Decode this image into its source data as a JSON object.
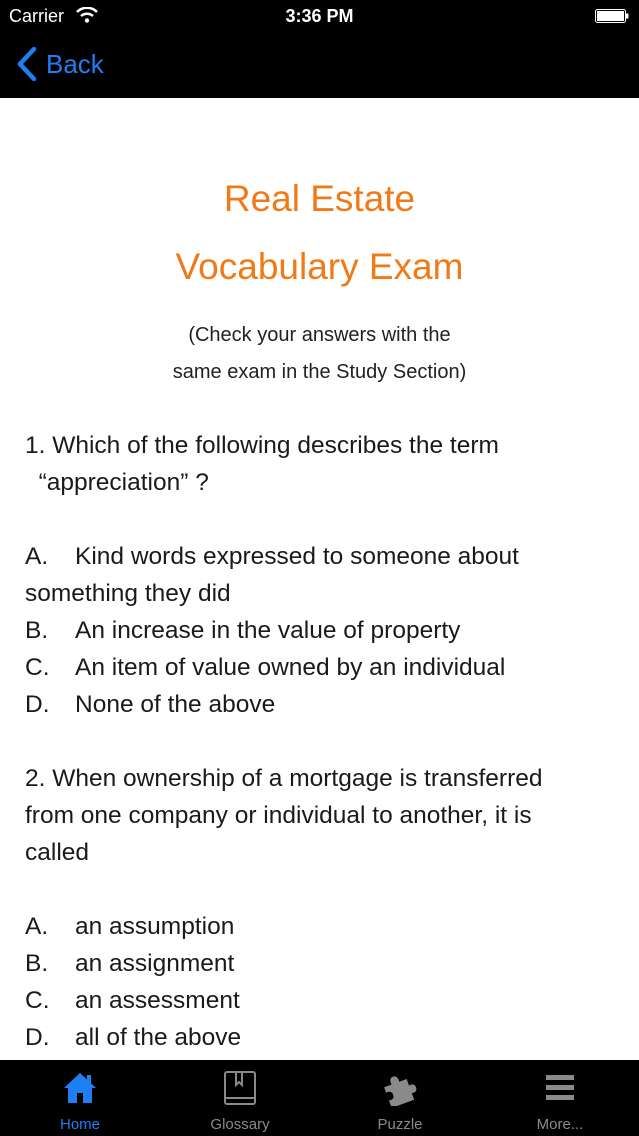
{
  "status_bar": {
    "carrier": "Carrier",
    "time": "3:36 PM"
  },
  "nav": {
    "back_label": "Back"
  },
  "header": {
    "title_line1": "Real Estate",
    "title_line2": "Vocabulary Exam",
    "subtitle_line1": "(Check your answers with the",
    "subtitle_line2": "same exam in the Study Section)"
  },
  "questions": [
    {
      "lines": [
        "1. Which of the following describes the term",
        "  “appreciation” ?"
      ],
      "options": [
        {
          "letter": "A.",
          "text": "Kind words expressed to someone about",
          "cont": "something they did"
        },
        {
          "letter": "B.",
          "text": "An increase in the value of property"
        },
        {
          "letter": "C.",
          "text": "An item of value owned by an individual"
        },
        {
          "letter": "D.",
          "text": "None of the above"
        }
      ]
    },
    {
      "lines": [
        "2. When ownership of a mortgage is transferred",
        "from one company or individual to another, it is",
        "called"
      ],
      "options": [
        {
          "letter": "A.",
          "text": "an assumption"
        },
        {
          "letter": "B.",
          "text": "an assignment"
        },
        {
          "letter": "C.",
          "text": "an assessment"
        },
        {
          "letter": "D.",
          "text": "all of the above"
        }
      ]
    }
  ],
  "tabs": [
    {
      "label": "Home",
      "icon": "home-icon",
      "active": true
    },
    {
      "label": "Glossary",
      "icon": "book-icon",
      "active": false
    },
    {
      "label": "Puzzle",
      "icon": "puzzle-icon",
      "active": false
    },
    {
      "label": "More...",
      "icon": "more-icon",
      "active": false
    }
  ],
  "colors": {
    "accent": "#1e7ff5",
    "title": "#f07a17",
    "inactive_tab": "#8a8a8a"
  }
}
